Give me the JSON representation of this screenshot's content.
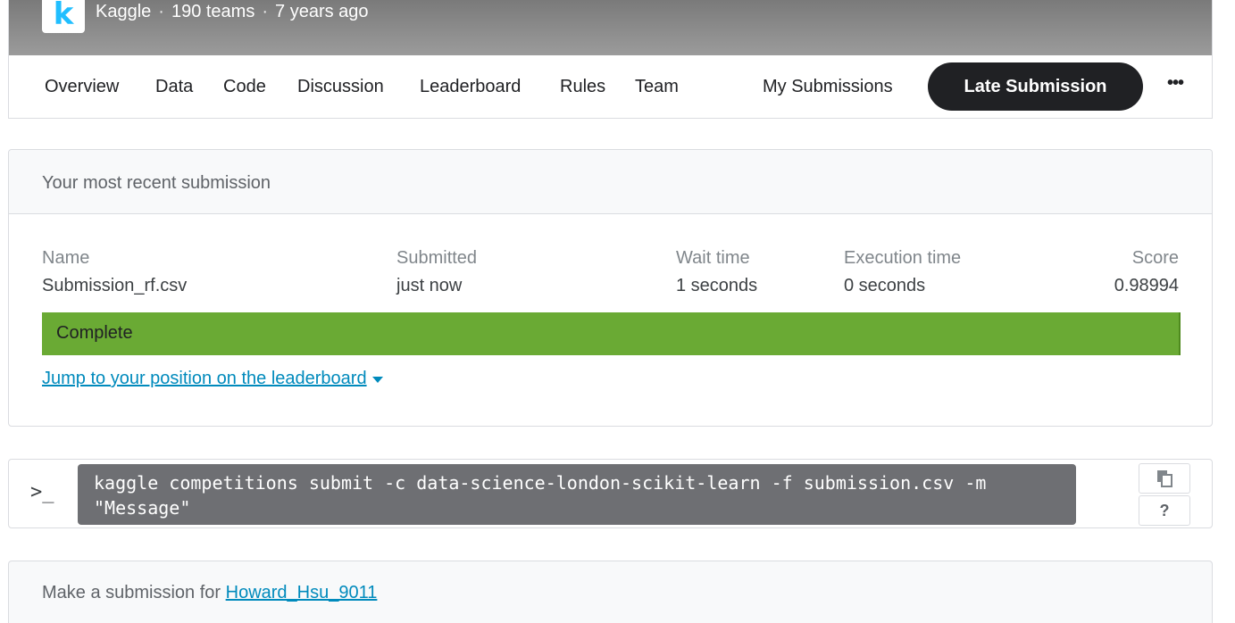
{
  "competition": {
    "host": "Kaggle",
    "teams": "190 teams",
    "age": "7 years ago",
    "logo_letter": "k",
    "logo_color": "#20beff"
  },
  "nav": {
    "items": [
      "Overview",
      "Data",
      "Code",
      "Discussion",
      "Leaderboard",
      "Rules",
      "Team"
    ],
    "my_submissions": "My Submissions",
    "late_submission": "Late Submission",
    "more": "•••"
  },
  "recent": {
    "heading": "Your most recent submission",
    "columns": {
      "name": {
        "label": "Name",
        "value": "Submission_rf.csv"
      },
      "submitted": {
        "label": "Submitted",
        "value": "just now"
      },
      "wait": {
        "label": "Wait time",
        "value": "1 seconds"
      },
      "execution": {
        "label": "Execution time",
        "value": "0 seconds"
      },
      "score": {
        "label": "Score",
        "value": "0.98994"
      }
    },
    "status": "Complete",
    "status_color": "#6aaa34",
    "jump_link": "Jump to your position on the leaderboard"
  },
  "cli": {
    "prompt": ">_",
    "command": "kaggle competitions submit -c data-science-london-scikit-learn -f submission.csv -m \"Message\"",
    "help": "?"
  },
  "make_submission": {
    "prefix": "Make a submission for",
    "user": "Howard_Hsu_9011"
  }
}
